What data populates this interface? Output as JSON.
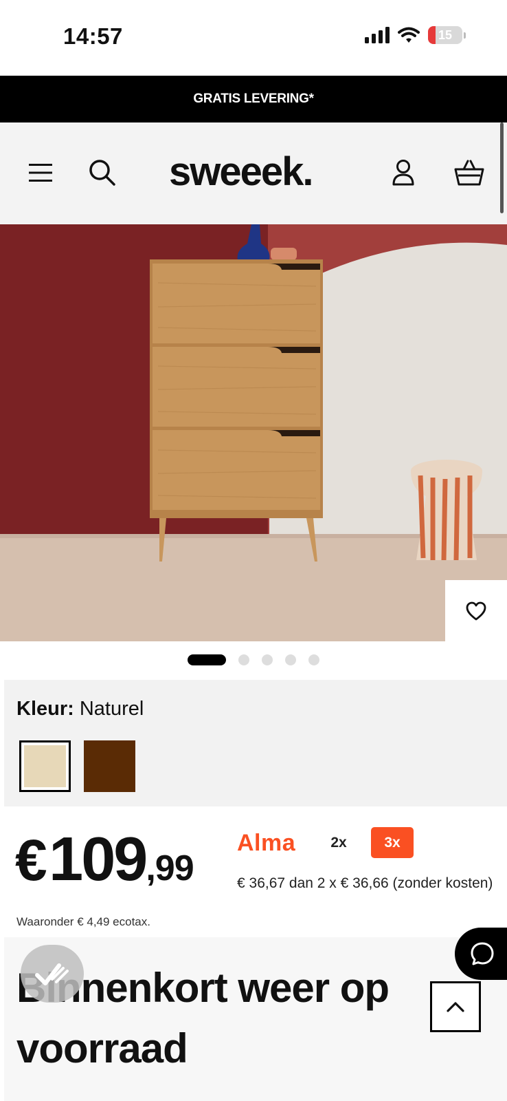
{
  "status_bar": {
    "time": "14:57",
    "battery": "15"
  },
  "promo": {
    "text": "GRATIS LEVERING*"
  },
  "header": {
    "logo": "sweeek."
  },
  "icons": {
    "menu": "hamburger-icon",
    "search": "search-icon",
    "account": "user-icon",
    "cart": "basket-icon",
    "favorite": "heart-icon",
    "chat": "chat-bubble-icon",
    "back_to_top": "chevron-up-icon",
    "check": "check-mark-icon"
  },
  "gallery": {
    "image_count": 5,
    "active_index": 0
  },
  "color": {
    "label": "Kleur:",
    "value": "Naturel",
    "swatches": [
      {
        "name": "Naturel",
        "hex": "#e7d8b8",
        "selected": true
      },
      {
        "name": "Bruin",
        "hex": "#5a2b05",
        "selected": false
      }
    ]
  },
  "price": {
    "euro": "€",
    "main": "109",
    "cents": ",99"
  },
  "alma": {
    "logo": "Alma",
    "option_2x": "2x",
    "option_3x": "3x",
    "info": "€ 36,67 dan 2 x € 36,66 (zonder kosten)",
    "accent": "#fa5022"
  },
  "ecotax": "Waaronder € 4,49 ecotax.",
  "stock": {
    "title": "Binnenkort weer op voorraad"
  }
}
